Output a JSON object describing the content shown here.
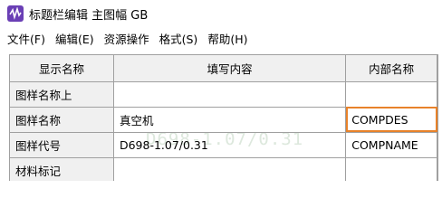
{
  "window": {
    "title": "标题栏编辑 主图幅 GB",
    "app_icon": "waveform-app-icon"
  },
  "menu": [
    {
      "label": "文件(F)"
    },
    {
      "label": "编辑(E)"
    },
    {
      "label": "资源操作"
    },
    {
      "label": "格式(S)"
    },
    {
      "label": "帮助(H)"
    }
  ],
  "grid": {
    "headers": {
      "display_name": "显示名称",
      "fill_content": "填写内容",
      "internal_name": "内部名称"
    },
    "rows": [
      {
        "display_name": "图样名称上",
        "fill_content": "",
        "internal_name": ""
      },
      {
        "display_name": "图样名称",
        "fill_content": "真空机",
        "internal_name": "COMPDES"
      },
      {
        "display_name": "图样代号",
        "fill_content": "D698-1.07/0.31",
        "internal_name": "COMPNAME"
      },
      {
        "display_name": "材料标记",
        "fill_content": "",
        "internal_name": ""
      }
    ],
    "highlight_color": "#e8822a"
  }
}
